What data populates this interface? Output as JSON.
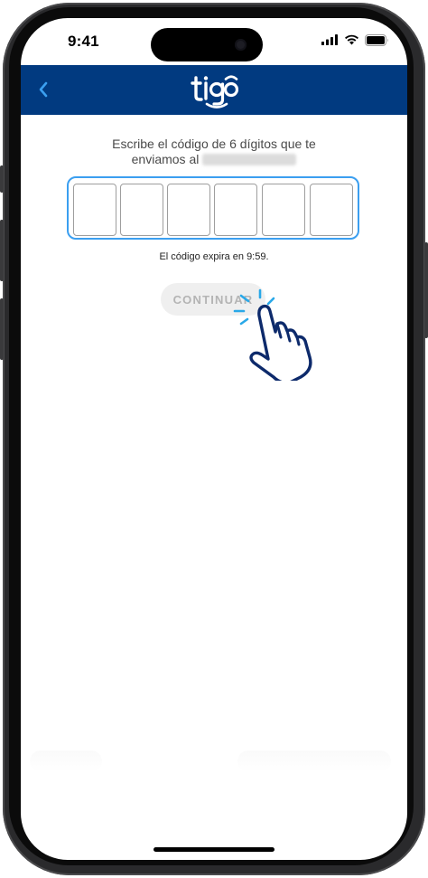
{
  "status_bar": {
    "time": "9:41",
    "icons": [
      "cellular-signal-icon",
      "wifi-icon",
      "battery-icon"
    ]
  },
  "header": {
    "background": "#013A80",
    "back_icon": "chevron-left-icon",
    "back_color": "#3B9FF0",
    "logo_text": "tigo"
  },
  "verification": {
    "prompt_line1": "Escribe el código de 6 dígitos que te",
    "prompt_line2": "enviamos al",
    "digits": [
      "",
      "",
      "",
      "",
      "",
      ""
    ],
    "expiry_text": "El código expira en 9:59.",
    "continue_label": "CONTINUAR"
  },
  "colors": {
    "accent": "#3B9FF0",
    "button_disabled_bg": "#EFEFEF",
    "button_disabled_text": "#B4B4B4",
    "hand_outline": "#0D2A6B"
  }
}
